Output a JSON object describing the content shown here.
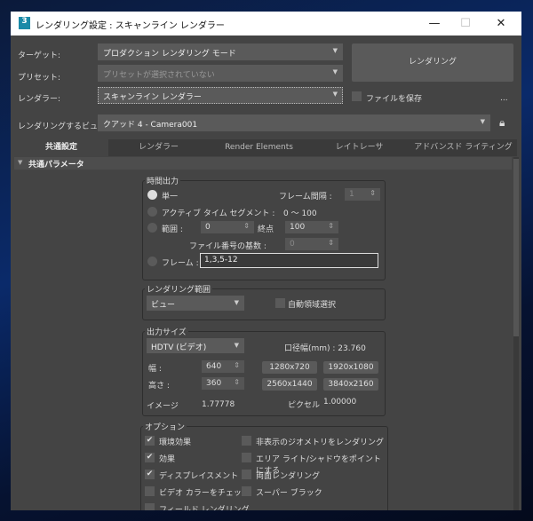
{
  "window": {
    "title": "レンダリング設定 : スキャンライン レンダラー",
    "app_icon_label": "3"
  },
  "header": {
    "target_label": "ターゲット:",
    "target_value": "プロダクション レンダリング モード",
    "preset_label": "プリセット:",
    "preset_value": "プリセットが選択されていない",
    "renderer_label": "レンダラー:",
    "renderer_value": "スキャンライン レンダラー",
    "render_button": "レンダリング",
    "save_file_label": "ファイルを保存",
    "more_button": "...",
    "view_label": "レンダリングするビュー:",
    "view_value": "クアッド 4 - Camera001"
  },
  "tabs": [
    {
      "label": "共通設定",
      "active": true
    },
    {
      "label": "レンダラー"
    },
    {
      "label": "Render Elements"
    },
    {
      "label": "レイトレーサ"
    },
    {
      "label": "アドバンスド ライティング"
    }
  ],
  "rollout": {
    "title": "共通パラメータ"
  },
  "time_output": {
    "title": "時間出力",
    "single": "単一",
    "frame_interval_label": "フレーム間隔 :",
    "frame_interval": "1",
    "active_segment": "アクティブ タイム セグメント :",
    "active_range": "0 〜 100",
    "range": "範囲 :",
    "range_start": "0",
    "end_label": "終点",
    "range_end": "100",
    "file_number_base_label": "ファイル番号の基数 :",
    "file_number_base": "0",
    "frames": "フレーム :",
    "frames_value": "1,3,5-12"
  },
  "render_area": {
    "title": "レンダリング範囲",
    "value": "ビュー",
    "auto_region": "自動領域選択"
  },
  "output_size": {
    "title": "出力サイズ",
    "preset": "HDTV (ビデオ)",
    "aperture": "口径幅(mm) : 23.760",
    "width_label": "幅 :",
    "width": "640",
    "height_label": "高さ :",
    "height": "360",
    "presets": [
      "1280x720",
      "1920x1080",
      "2560x1440",
      "3840x2160"
    ],
    "image_aspect_label": "イメージ",
    "image_aspect": "1.77778",
    "pixel_aspect_label": "ピクセル",
    "pixel_aspect": "1.00000"
  },
  "options": {
    "title": "オプション",
    "left": [
      {
        "label": "環境効果",
        "checked": true
      },
      {
        "label": "効果",
        "checked": true
      },
      {
        "label": "ディスプレイスメント",
        "checked": true
      },
      {
        "label": "ビデオ カラーをチェック",
        "checked": false
      },
      {
        "label": "フィールド レンダリング",
        "checked": false
      }
    ],
    "right": [
      {
        "label": "非表示のジオメトリをレンダリング",
        "checked": false
      },
      {
        "label": "エリア ライト/シャドウをポイントにする",
        "checked": false
      },
      {
        "label": "両面レンダリング",
        "checked": false
      },
      {
        "label": "スーパー ブラック",
        "checked": false
      }
    ]
  }
}
